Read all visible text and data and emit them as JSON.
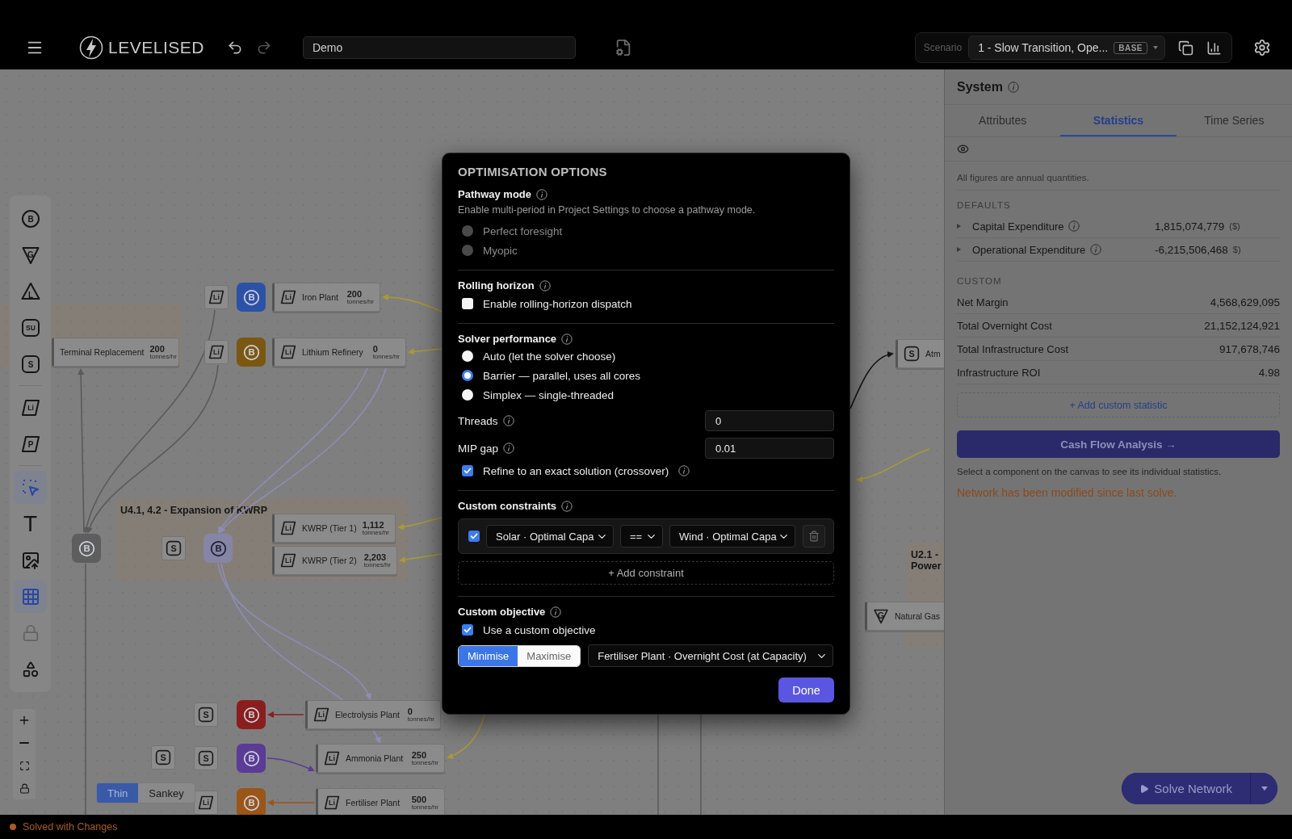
{
  "topbar": {
    "brand": "LEVELISED",
    "project_name": "Demo",
    "scenario_label": "Scenario",
    "scenario": "1 - Slow Transition, Ope...",
    "scenario_badge": "BASE"
  },
  "toolbar": {
    "groups": [
      {
        "tools": [
          {
            "kind": "circle",
            "glyph": "B",
            "selected": false,
            "disabled": false
          },
          {
            "kind": "shield",
            "glyph": "G",
            "selected": false,
            "disabled": false
          },
          {
            "kind": "triangle",
            "glyph": "L",
            "selected": false,
            "disabled": false
          },
          {
            "kind": "square",
            "glyph": "SU",
            "selected": false,
            "disabled": false
          },
          {
            "kind": "square",
            "glyph": "S",
            "selected": false,
            "disabled": false
          }
        ]
      },
      {
        "tools": [
          {
            "kind": "parallelogram",
            "glyph": "Li",
            "selected": false,
            "disabled": false
          },
          {
            "kind": "parallelogram",
            "glyph": "P",
            "selected": false,
            "disabled": false
          }
        ]
      },
      {
        "tools": [
          {
            "kind": "select",
            "selected": true,
            "disabled": false
          },
          {
            "kind": "text",
            "glyph": "T",
            "selected": false,
            "disabled": false
          },
          {
            "kind": "image",
            "selected": false,
            "disabled": false
          },
          {
            "kind": "grid",
            "selected": true,
            "disabled": false
          },
          {
            "kind": "lock",
            "selected": false,
            "disabled": true
          },
          {
            "kind": "shapes",
            "selected": false,
            "disabled": false
          }
        ]
      }
    ]
  },
  "canvas": {
    "groups": [
      {
        "label": "U4.1, 4.2 - Expansion of KWRP"
      },
      {
        "label": "U2.1 -",
        "label_2": "Power"
      }
    ],
    "nodes": [
      {
        "kind": "parallelogram",
        "glyph": "Li",
        "name": "Iron Plant",
        "value": "200",
        "unit": "tonnes/hr"
      },
      {
        "kind": "none",
        "name": "Terminal Replacement",
        "value": "200",
        "unit": "tonnes/hr"
      },
      {
        "kind": "parallelogram",
        "glyph": "Li",
        "name": "Lithium Refinery",
        "value": "0",
        "unit": "tonnes/hr"
      },
      {
        "kind": "parallelogram",
        "glyph": "Li",
        "name": "KWRP (Tier 1)",
        "value": "1,112",
        "unit": "tonnes/hr"
      },
      {
        "kind": "parallelogram",
        "glyph": "Li",
        "name": "KWRP (Tier 2)",
        "value": "2,203",
        "unit": "tonnes/hr"
      },
      {
        "kind": "parallelogram",
        "glyph": "Li",
        "name": "Electrolysis Plant",
        "value": "0",
        "unit": "tonnes/hr"
      },
      {
        "kind": "parallelogram",
        "glyph": "Li",
        "name": "Ammonia Plant",
        "value": "250",
        "unit": "tonnes/hr"
      },
      {
        "kind": "parallelogram",
        "glyph": "Li",
        "name": "Fertiliser Plant",
        "value": "500",
        "unit": "tonnes/hr"
      },
      {
        "kind": "square",
        "glyph": "S",
        "name": "Atm"
      },
      {
        "kind": "shield",
        "glyph": "G",
        "name": "Natural Gas"
      }
    ],
    "buses": [
      {
        "glyph": "B",
        "color": "#2c52a8"
      },
      {
        "glyph": "B",
        "color": "#7a5812"
      },
      {
        "glyph": "B",
        "color": "#5e5e5e"
      },
      {
        "glyph": "B",
        "color": "#8585a6"
      },
      {
        "glyph": "B",
        "color": "#8a1e1e"
      },
      {
        "glyph": "B",
        "color": "#5a3b96"
      },
      {
        "glyph": "B",
        "color": "#9a5519"
      }
    ],
    "ports": [
      {
        "kind": "parallelogram",
        "glyph": "Li"
      },
      {
        "kind": "parallelogram",
        "glyph": "Li"
      },
      {
        "kind": "square",
        "glyph": "S"
      },
      {
        "kind": "square",
        "glyph": "S"
      },
      {
        "kind": "square",
        "glyph": "S"
      },
      {
        "kind": "square",
        "glyph": "S"
      },
      {
        "kind": "parallelogram",
        "glyph": "Li"
      }
    ],
    "line_styles": [
      {
        "label": "Thin",
        "selected": true
      },
      {
        "label": "Sankey",
        "selected": false
      }
    ]
  },
  "panel": {
    "title": "System",
    "tabs": [
      {
        "label": "Attributes",
        "selected": false
      },
      {
        "label": "Statistics",
        "selected": true
      },
      {
        "label": "Time Series",
        "selected": false
      }
    ],
    "note": "All figures are annual quantities.",
    "defaults_heading": "DEFAULTS",
    "defaults": [
      {
        "label": "Capital Expenditure",
        "value": "1,815,074,779",
        "unit": "($)",
        "expanded": false
      },
      {
        "label": "Operational Expenditure",
        "value": "-6,215,506,468",
        "unit": "$)",
        "expanded": false
      }
    ],
    "custom_heading": "CUSTOM",
    "custom": [
      {
        "label": "Net Margin",
        "value": "4,568,629,095"
      },
      {
        "label": "Total Overnight Cost",
        "value": "21,152,124,921"
      },
      {
        "label": "Total Infrastructure Cost",
        "value": "917,678,746"
      },
      {
        "label": "Infrastructure ROI",
        "value": "4.98"
      }
    ],
    "add_statistic": "+ Add custom statistic",
    "cash_flow": "Cash Flow Analysis →",
    "help": "Select a component on the canvas to see its individual statistics.",
    "warning": "Network has been modified since last solve.",
    "solve": "Solve Network"
  },
  "dialog": {
    "title": "OPTIMISATION OPTIONS",
    "pathway": {
      "heading": "Pathway mode",
      "description": "Enable multi-period in Project Settings to choose a pathway mode.",
      "options": [
        {
          "label": "Perfect foresight",
          "selected": false,
          "disabled": true
        },
        {
          "label": "Myopic",
          "selected": false,
          "disabled": true
        }
      ]
    },
    "rolling": {
      "heading": "Rolling horizon",
      "label": "Enable rolling-horizon dispatch",
      "checked": false
    },
    "solver": {
      "heading": "Solver performance",
      "options": [
        {
          "label": "Auto (let the solver choose)",
          "selected": false,
          "disabled": false
        },
        {
          "label": "Barrier — parallel, uses all cores",
          "selected": true,
          "disabled": false
        },
        {
          "label": "Simplex — single-threaded",
          "selected": false,
          "disabled": false
        }
      ],
      "threads_label": "Threads",
      "threads": "0",
      "mip_label": "MIP gap",
      "mip": "0.01",
      "crossover_label": "Refine to an exact solution (crossover)",
      "crossover": true
    },
    "constraints": {
      "heading": "Custom constraints",
      "rows": [
        {
          "enabled": true,
          "left": "Solar · Optimal Capa",
          "operator": "==",
          "right": "Wind · Optimal Capa"
        }
      ],
      "add": "+ Add constraint"
    },
    "objective": {
      "heading": "Custom objective",
      "label": "Use a custom objective",
      "checked": true,
      "senses": [
        {
          "label": "Minimise",
          "selected": true
        },
        {
          "label": "Maximise",
          "selected": false
        }
      ],
      "target": "Fertiliser Plant · Overnight Cost (at Capacity)"
    },
    "done": "Done"
  },
  "status": "Solved with Changes"
}
